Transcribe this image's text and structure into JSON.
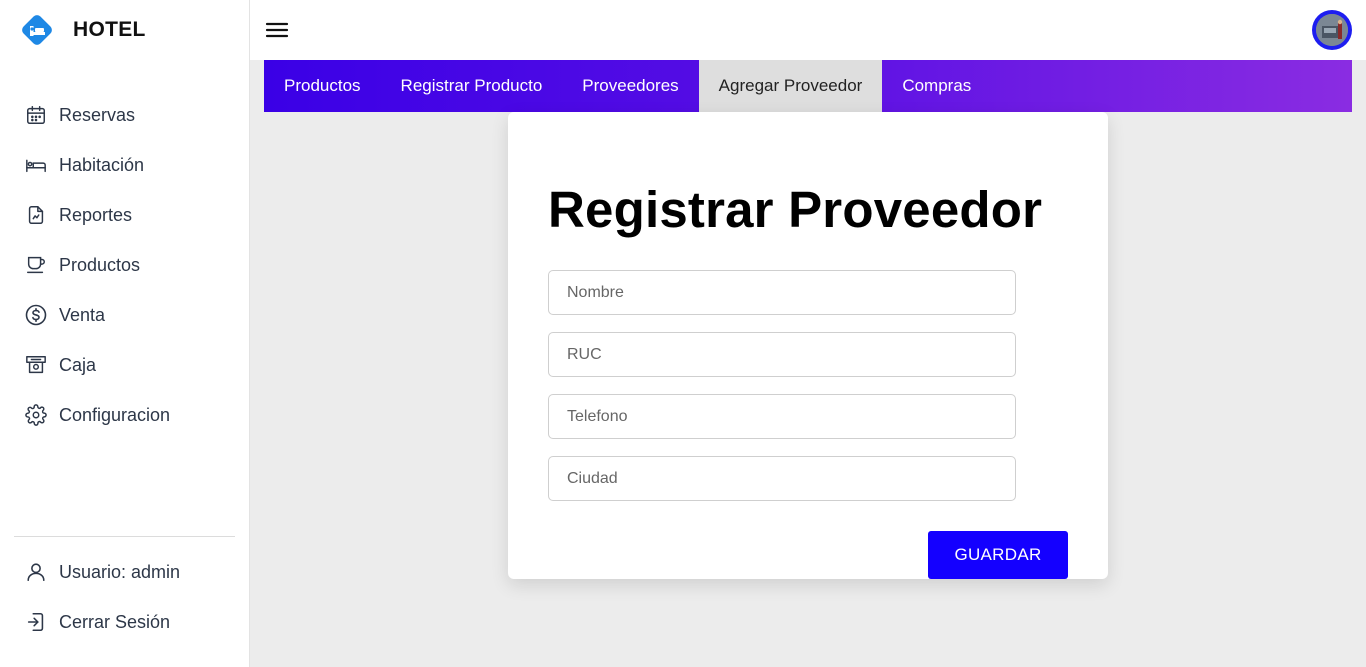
{
  "brand": {
    "name": "HOTEL"
  },
  "sidebar": {
    "items": [
      {
        "label": "Reservas",
        "icon": "calendar-icon"
      },
      {
        "label": "Habitación",
        "icon": "bed-icon"
      },
      {
        "label": "Reportes",
        "icon": "report-icon"
      },
      {
        "label": "Productos",
        "icon": "cup-icon"
      },
      {
        "label": "Venta",
        "icon": "dollar-icon"
      },
      {
        "label": "Caja",
        "icon": "cash-register-icon"
      },
      {
        "label": "Configuracion",
        "icon": "gear-icon"
      }
    ],
    "bottom": [
      {
        "label": "Usuario: admin",
        "icon": "user-icon"
      },
      {
        "label": "Cerrar Sesión",
        "icon": "logout-icon"
      }
    ]
  },
  "tabs": [
    {
      "label": "Productos",
      "active": false
    },
    {
      "label": "Registrar Producto",
      "active": false
    },
    {
      "label": "Proveedores",
      "active": false
    },
    {
      "label": "Agregar Proveedor",
      "active": true
    },
    {
      "label": "Compras",
      "active": false
    }
  ],
  "form": {
    "title": "Registrar Proveedor",
    "fields": [
      {
        "placeholder": "Nombre",
        "value": ""
      },
      {
        "placeholder": "RUC",
        "value": ""
      },
      {
        "placeholder": "Telefono",
        "value": ""
      },
      {
        "placeholder": "Ciudad",
        "value": ""
      }
    ],
    "submit_label": "GUARDAR"
  },
  "colors": {
    "accent": "#1400ff",
    "tab_gradient_start": "#3a00e6",
    "tab_gradient_end": "#8a2ce2",
    "active_tab_bg": "#dedede",
    "brand_icon": "#1e88e5"
  }
}
